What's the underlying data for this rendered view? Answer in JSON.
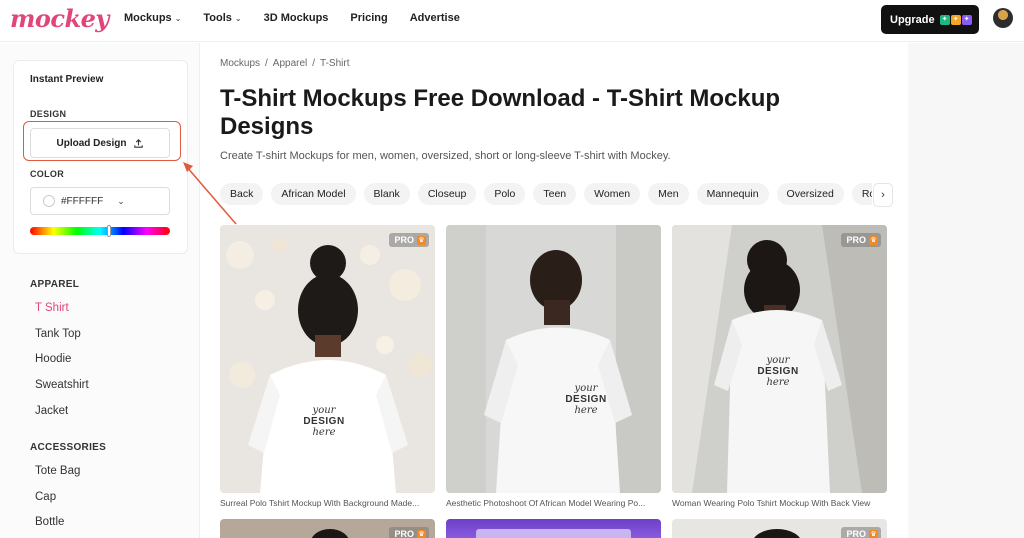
{
  "header": {
    "logo": "mockey",
    "nav": [
      {
        "label": "Mockups",
        "has_menu": true
      },
      {
        "label": "Tools",
        "has_menu": true
      },
      {
        "label": "3D Mockups",
        "has_menu": false
      },
      {
        "label": "Pricing",
        "has_menu": false
      },
      {
        "label": "Advertise",
        "has_menu": false
      }
    ],
    "upgrade_label": "Upgrade"
  },
  "sidebar": {
    "preview_title": "Instant Preview",
    "design_label": "DESIGN",
    "upload_label": "Upload Design",
    "color_label": "COLOR",
    "color_value": "#FFFFFF",
    "sections": [
      {
        "title": "APPAREL",
        "items": [
          "T Shirt",
          "Tank Top",
          "Hoodie",
          "Sweatshirt",
          "Jacket"
        ],
        "active": "T Shirt"
      },
      {
        "title": "ACCESSORIES",
        "items": [
          "Tote Bag",
          "Cap",
          "Bottle"
        ]
      }
    ]
  },
  "main": {
    "breadcrumb": [
      "Mockups",
      "Apparel",
      "T-Shirt"
    ],
    "title": "T-Shirt Mockups Free Download - T-Shirt Mockup Designs",
    "subtitle": "Create T-shirt Mockups for men, women, oversized, short or long-sleeve T-shirt with Mockey.",
    "chips": [
      "Back",
      "African Model",
      "Blank",
      "Closeup",
      "Polo",
      "Teen",
      "Women",
      "Men",
      "Mannequin",
      "Oversized",
      "Round N"
    ],
    "print_text": {
      "your": "your",
      "design": "DESIGN",
      "here": "here"
    },
    "cards": [
      {
        "caption": "Surreal Polo Tshirt Mockup With Background Made...",
        "pro": "PRO"
      },
      {
        "caption": "Aesthetic Photoshoot Of African Model Wearing Po...",
        "pro": ""
      },
      {
        "caption": "Woman Wearing Polo Tshirt Mockup With Back View",
        "pro": "PRO"
      }
    ],
    "second_row_badges": [
      "PRO",
      "",
      "PRO"
    ]
  },
  "colors": {
    "accent": "#e0467a",
    "annotation": "#e05a3e",
    "upgrade_bg": "#111111"
  }
}
